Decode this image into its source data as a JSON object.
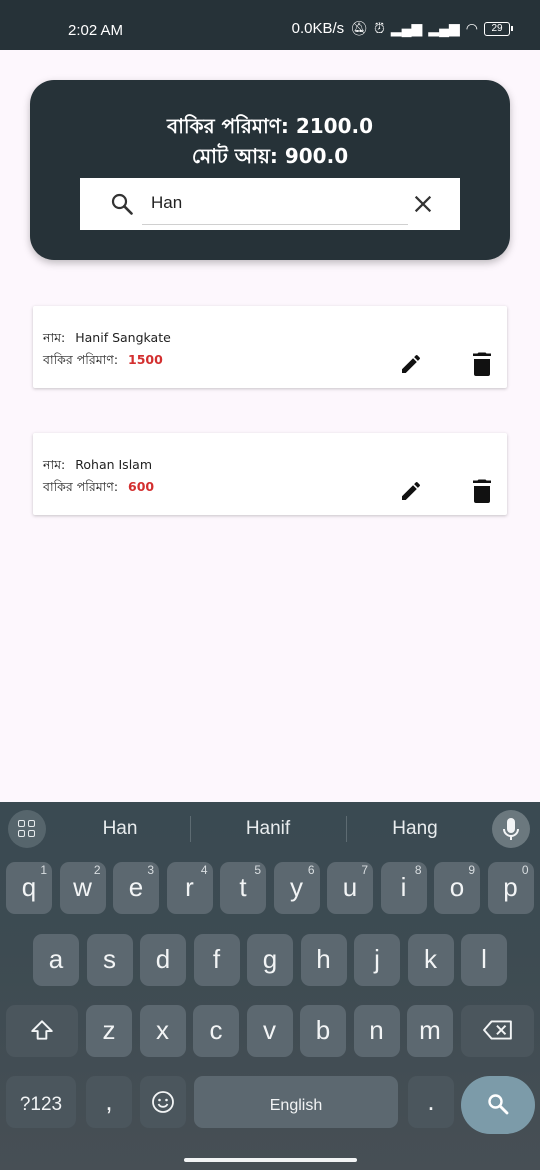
{
  "status_bar": {
    "time": "2:02 AM",
    "speed": "0.0KB/s",
    "battery": "29"
  },
  "header": {
    "due_amount": "বাকির পরিমাণ: 2100.0",
    "total_income": "মোট আয়: 900.0"
  },
  "search": {
    "value": "Han"
  },
  "records": [
    {
      "name_label": "নাম:",
      "name": "Hanif Sangkate",
      "due_label": "বাকির পরিমাণ:",
      "due": "1500"
    },
    {
      "name_label": "নাম:",
      "name": "Rohan Islam",
      "due_label": "বাকির পরিমাণ:",
      "due": "600"
    }
  ],
  "keyboard": {
    "suggestions": [
      "Han",
      "Hanif",
      "Hang"
    ],
    "row1": [
      "q",
      "w",
      "e",
      "r",
      "t",
      "y",
      "u",
      "i",
      "o",
      "p"
    ],
    "row1_hints": [
      "1",
      "2",
      "3",
      "4",
      "5",
      "6",
      "7",
      "8",
      "9",
      "0"
    ],
    "row2": [
      "a",
      "s",
      "d",
      "f",
      "g",
      "h",
      "j",
      "k",
      "l"
    ],
    "row3": [
      "z",
      "x",
      "c",
      "v",
      "b",
      "n",
      "m"
    ],
    "symbols_label": "?123",
    "comma": ",",
    "space_label": "English",
    "period": "."
  },
  "colors": {
    "primary_dark": "#263238",
    "due_red": "#d32f2f",
    "background": "#fdf7fd"
  }
}
